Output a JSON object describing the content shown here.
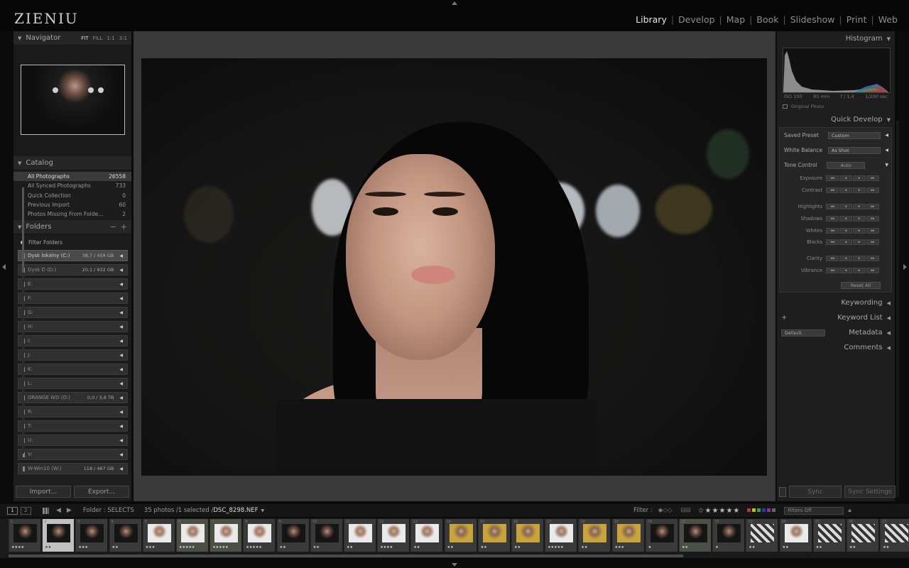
{
  "brand": "ZIENIU",
  "modules": [
    "Library",
    "Develop",
    "Map",
    "Book",
    "Slideshow",
    "Print",
    "Web"
  ],
  "active_module": "Library",
  "left": {
    "navigator": {
      "title": "Navigator",
      "options": [
        "FIT",
        "FILL",
        "1:1",
        "3:1"
      ]
    },
    "catalog": {
      "title": "Catalog",
      "items": [
        {
          "label": "All Photographs",
          "count": "26558"
        },
        {
          "label": "All Synced Photographs",
          "count": "733"
        },
        {
          "label": "Quick Collection",
          "count": "0"
        },
        {
          "label": "Previous Import",
          "count": "60"
        },
        {
          "label": "Photos Missing From Folde...",
          "count": "2"
        }
      ]
    },
    "folders": {
      "title": "Folders",
      "filter_label": "Filter Folders",
      "volumes": [
        {
          "label": "Dysk lokalny (C:)",
          "info": "38,7 / 458 GB",
          "active": true
        },
        {
          "label": "Dysk D (D:)",
          "info": "20,1 / 932 GB"
        },
        {
          "label": "E:",
          "info": ""
        },
        {
          "label": "F:",
          "info": ""
        },
        {
          "label": "G:",
          "info": ""
        },
        {
          "label": "H:",
          "info": ""
        },
        {
          "label": "I:",
          "info": ""
        },
        {
          "label": "J:",
          "info": ""
        },
        {
          "label": "K:",
          "info": ""
        },
        {
          "label": "L:",
          "info": ""
        },
        {
          "label": "ORANGE WD (O:)",
          "info": "0,0 / 3,6 TB"
        },
        {
          "label": "R:",
          "info": ""
        },
        {
          "label": "T:",
          "info": ""
        },
        {
          "label": "U:",
          "info": ""
        },
        {
          "label": "V:",
          "info": ""
        },
        {
          "label": "W-Win10 (W:)",
          "info": "118 / 467 GB"
        }
      ]
    },
    "import_label": "Import...",
    "export_label": "Export..."
  },
  "right": {
    "histogram": {
      "title": "Histogram",
      "iso": "ISO 100",
      "focal": "85 mm",
      "aperture": "f / 1,4",
      "shutter": "1/200 sec",
      "original": "Original Photo"
    },
    "quick_develop": {
      "title": "Quick Develop",
      "saved_preset": {
        "label": "Saved Preset",
        "value": "Custom"
      },
      "white_balance": {
        "label": "White Balance",
        "value": "As Shot"
      },
      "tone_control": {
        "label": "Tone Control",
        "auto": "Auto"
      },
      "adjustments": [
        "Exposure",
        "Contrast",
        "Highlights",
        "Shadows",
        "Whites",
        "Blacks",
        "Clarity",
        "Vibrance"
      ],
      "reset": "Reset All"
    },
    "keywording": "Keywording",
    "keyword_list": "Keyword List",
    "metadata": {
      "title": "Metadata",
      "preset": "Default"
    },
    "comments": "Comments",
    "sync_label": "Sync",
    "sync_settings_label": "Sync Settings"
  },
  "toolbar": {
    "screen1": "1",
    "screen2": "2",
    "folder_label": "Folder : SELECTS",
    "count": "35 photos /1 selected /",
    "filename": "DSC_8298.NEF",
    "filter_label": "Filter :",
    "filters_off": "Filters Off"
  },
  "filmstrip": [
    {
      "i": "1",
      "r": "★★★★",
      "s": "dark"
    },
    {
      "i": "2",
      "r": "★★",
      "s": "dark",
      "sel": true
    },
    {
      "i": "3",
      "r": "★★★",
      "s": "dark"
    },
    {
      "i": "4",
      "r": "★★",
      "s": "dark"
    },
    {
      "i": "5",
      "r": "★★★",
      "s": "light"
    },
    {
      "i": "6",
      "r": "★★★★★",
      "s": "light",
      "pick": true
    },
    {
      "i": "7",
      "r": "★★★★★",
      "s": "light",
      "pick": true
    },
    {
      "i": "8",
      "r": "★★★★★",
      "s": "light"
    },
    {
      "i": "9",
      "r": "★★",
      "s": "dark"
    },
    {
      "i": "10",
      "r": "★★",
      "s": "dark"
    },
    {
      "i": "11",
      "r": "★★",
      "s": "light"
    },
    {
      "i": "12",
      "r": "★★★★",
      "s": "light"
    },
    {
      "i": "13",
      "r": "★★",
      "s": "light"
    },
    {
      "i": "14",
      "r": "★★",
      "s": "amber"
    },
    {
      "i": "15",
      "r": "★★",
      "s": "amber"
    },
    {
      "i": "16",
      "r": "★★",
      "s": "amber"
    },
    {
      "i": "17",
      "r": "★★★★★",
      "s": "light"
    },
    {
      "i": "18",
      "r": "★★",
      "s": "amber"
    },
    {
      "i": "19",
      "r": "★★★",
      "s": "amber"
    },
    {
      "i": "20",
      "r": "★",
      "s": "dark"
    },
    {
      "i": "21",
      "r": "★★",
      "s": "dark",
      "pick": true
    },
    {
      "i": "22",
      "r": "★",
      "s": "dark"
    },
    {
      "i": "23",
      "r": "★★",
      "s": "zebra"
    },
    {
      "i": "24",
      "r": "★★",
      "s": "light"
    },
    {
      "i": "25",
      "r": "★★",
      "s": "zebra"
    },
    {
      "i": "26",
      "r": "★★",
      "s": "zebra"
    },
    {
      "i": "27",
      "r": "★★",
      "s": "zebra"
    }
  ]
}
